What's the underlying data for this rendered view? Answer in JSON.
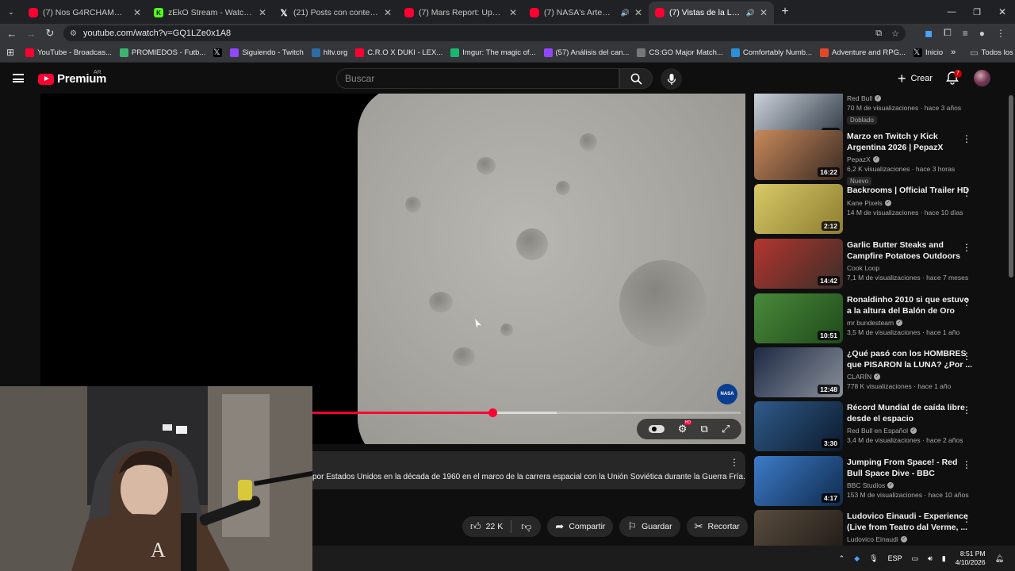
{
  "browser": {
    "tabs": [
      {
        "title": "(7) Nos G4RCHAMOS a TODOS",
        "favicon": "youtube-icon",
        "active": false
      },
      {
        "title": "zEkO Stream - Watch Live on Kick",
        "favicon": "kick-icon",
        "active": false
      },
      {
        "title": "(21) Posts con contenido multimedia",
        "favicon": "x-icon",
        "active": false
      },
      {
        "title": "(7) Mars Report: Update on NASA",
        "favicon": "youtube-icon",
        "active": false
      },
      {
        "title": "(7) NASA's Artemis II Crew",
        "favicon": "youtube-icon",
        "active": false
      },
      {
        "title": "(7) Vistas de la Luna del Apolo",
        "favicon": "youtube-icon",
        "active": true
      }
    ],
    "url": "youtube.com/watch?v=GQ1LZe0x1A8",
    "bookmarks": [
      {
        "label": "YouTube - Broadcas...",
        "color": "#ff0033"
      },
      {
        "label": "PROMIEDOS - Futb...",
        "color": "#3cb371"
      },
      {
        "label": "",
        "color": "#000000"
      },
      {
        "label": "Siguiendo - Twitch",
        "color": "#9146ff"
      },
      {
        "label": "hltv.org",
        "color": "#2d6da3"
      },
      {
        "label": "C.R.O X DUKI - LEX...",
        "color": "#ff0033"
      },
      {
        "label": "Imgur: The magic of...",
        "color": "#1bb76e"
      },
      {
        "label": "(57) Análisis del can...",
        "color": "#9146ff"
      },
      {
        "label": "CS:GO Major Match...",
        "color": "#777777"
      },
      {
        "label": "Comfortably Numb...",
        "color": "#2b8fd6"
      },
      {
        "label": "Adventure and RPG...",
        "color": "#e0482c"
      },
      {
        "label": "Inicio",
        "color": "#000000"
      }
    ],
    "bookmarks_all": "Todos los favoritos"
  },
  "youtube": {
    "logo_text": "Premium",
    "country": "AR",
    "search_placeholder": "Buscar",
    "create_label": "Crear",
    "notifications": "7"
  },
  "player": {
    "progress_fraction": 0.42,
    "buffered_fraction": 0.57
  },
  "description": {
    "text": "por Estados Unidos en la década de 1960 en el marco de la carrera espacial con la Unión Soviética durante la Guerra Fría."
  },
  "actions": {
    "likes": "22 K",
    "share": "Compartir",
    "save": "Guardar",
    "clip": "Recortar"
  },
  "recommendations": [
    {
      "title": "",
      "channel": "Red Bull",
      "verified": true,
      "stats": "70 M de visualizaciones · hace 3 años",
      "duration": "3:30",
      "tag": "Doblado",
      "colors": [
        "#cfd6de",
        "#2b3440"
      ]
    },
    {
      "title": "Marzo en Twitch y Kick Argentina 2026 | PepazX",
      "channel": "PepazX",
      "verified": true,
      "stats": "6,2 K visualizaciones · hace 3 horas",
      "duration": "16:22",
      "tag": "Nuevo",
      "colors": [
        "#c98a5a",
        "#3a2a24"
      ]
    },
    {
      "title": "Backrooms | Official Trailer HD",
      "channel": "Kane Pixels",
      "verified": true,
      "stats": "14 M de visualizaciones · hace 10 días",
      "duration": "2:12",
      "tag": "",
      "colors": [
        "#d8c968",
        "#8d7d2f"
      ]
    },
    {
      "title": "Garlic Butter Steaks and Campfire Potatoes Outdoors",
      "channel": "Cook Loop",
      "verified": false,
      "stats": "7,1 M de visualizaciones · hace 7 meses",
      "duration": "14:42",
      "tag": "",
      "colors": [
        "#b5352f",
        "#3a2e28"
      ]
    },
    {
      "title": "Ronaldinho 2010 si que estuvo a la altura del Balón de Oro",
      "channel": "mr bundesteam",
      "verified": true,
      "stats": "3,5 M de visualizaciones · hace 1 año",
      "duration": "10:51",
      "tag": "",
      "colors": [
        "#4a8a3b",
        "#1f4a1a"
      ]
    },
    {
      "title": "¿Qué pasó con los HOMBRES que PISARON la LUNA? ¿Por ...",
      "channel": "CLARÍN",
      "verified": true,
      "stats": "778 K visualizaciones · hace 1 año",
      "duration": "12:48",
      "tag": "",
      "colors": [
        "#1d2a44",
        "#8a8f99"
      ]
    },
    {
      "title": "Récord Mundial de caída libre desde el espacio",
      "channel": "Red Bull en Español",
      "verified": true,
      "stats": "3,4 M de visualizaciones · hace 2 años",
      "duration": "3:30",
      "tag": "",
      "colors": [
        "#2f5b8a",
        "#0c1a2c"
      ]
    },
    {
      "title": "Jumping From Space! - Red Bull Space Dive - BBC",
      "channel": "BBC Studios",
      "verified": true,
      "stats": "153 M de visualizaciones · hace 10 años",
      "duration": "4:17",
      "tag": "",
      "colors": [
        "#3d7cc9",
        "#0f2a4d"
      ]
    },
    {
      "title": "Ludovico Einaudi - Experience (Live from Teatro dal Verme, ...",
      "channel": "Ludovico Einaudi",
      "verified": true,
      "stats": "",
      "duration": "",
      "tag": "",
      "colors": [
        "#5a4d3f",
        "#1d1814"
      ]
    }
  ],
  "taskbar": {
    "lang": "ESP",
    "time": "8:51 PM",
    "date": "4/10/2026"
  }
}
